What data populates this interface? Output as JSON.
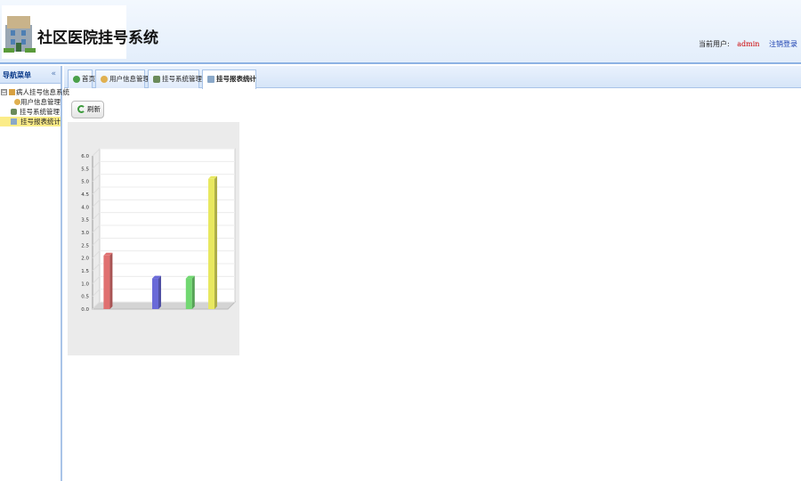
{
  "header": {
    "title": "社区医院挂号系统",
    "user_label": "当前用户:",
    "user_name": "admin",
    "logout": "注销登录"
  },
  "sidebar": {
    "title": "导航菜单",
    "root": {
      "label": "病人挂号信息系统",
      "toggle": "⊟"
    },
    "items": [
      {
        "label": "用户信息管理",
        "icon": "user-icon"
      },
      {
        "label": "挂号系统管理",
        "icon": "gear-icon"
      },
      {
        "label": "挂号报表统计",
        "icon": "chart-icon"
      }
    ]
  },
  "tabs": [
    {
      "label": "首页",
      "icon": "home-icon",
      "closable": false
    },
    {
      "label": "用户信息管理",
      "icon": "user-icon",
      "closable": true
    },
    {
      "label": "挂号系统管理",
      "icon": "gear-icon",
      "closable": true
    },
    {
      "label": "挂号报表统计",
      "icon": "chart-icon",
      "closable": true,
      "active": true
    }
  ],
  "close_glyph": "×",
  "toolbar": {
    "refresh_label": "刷新",
    "refresh_icon": "refresh-icon"
  },
  "chart_data": {
    "type": "bar",
    "categories": [
      "",
      "",
      "",
      ""
    ],
    "values": [
      2.1,
      1.2,
      1.2,
      5.1
    ],
    "colors": [
      "#e07070",
      "#6a6ad8",
      "#72d872",
      "#e8e860"
    ],
    "ylim": [
      0,
      6.0
    ],
    "yticks": [
      "0.0",
      "0.5",
      "1.0",
      "1.5",
      "2.0",
      "2.5",
      "3.0",
      "3.5",
      "4.0",
      "4.5",
      "5.0",
      "5.5",
      "6.0"
    ],
    "grid": true,
    "legend": "none"
  }
}
